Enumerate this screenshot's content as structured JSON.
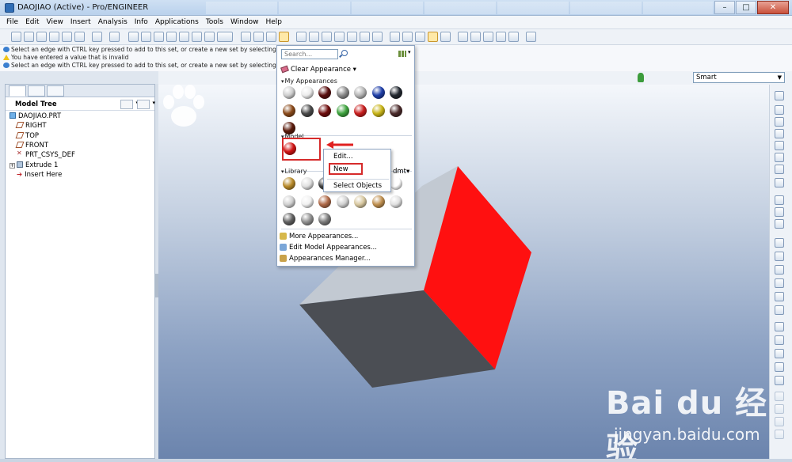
{
  "window": {
    "title": "DAOJIAO (Active) - Pro/ENGINEER",
    "controls": [
      "–",
      "□",
      "✕"
    ]
  },
  "menubar": [
    "File",
    "Edit",
    "View",
    "Insert",
    "Analysis",
    "Info",
    "Applications",
    "Tools",
    "Window",
    "Help"
  ],
  "messages": [
    {
      "text": "Select an edge with CTRL key pressed to add to this set, or create a new set by selecting an edge or a",
      "type": "info"
    },
    {
      "text": "You have entered a value that is invalid",
      "type": "warning"
    },
    {
      "text": "Select an edge with CTRL key pressed to add to this set, or create a new set by selecting an edge or a",
      "type": "info"
    }
  ],
  "filter": {
    "value": "Smart"
  },
  "model_tree": {
    "title": "Model Tree",
    "items": [
      {
        "label": "DAOJIAO.PRT",
        "icon": "part-icon"
      },
      {
        "label": "RIGHT",
        "icon": "datum-plane-icon"
      },
      {
        "label": "TOP",
        "icon": "datum-plane-icon"
      },
      {
        "label": "FRONT",
        "icon": "datum-plane-icon"
      },
      {
        "label": "PRT_CSYS_DEF",
        "icon": "csys-icon"
      },
      {
        "label": "Extrude 1",
        "icon": "extrude-icon"
      },
      {
        "label": "Insert Here",
        "icon": "insert-here-icon"
      }
    ]
  },
  "appearance_menu": {
    "search_placeholder": "Search...",
    "clear_label": "Clear Appearance",
    "my_label": "My Appearances",
    "model_label": "Model",
    "library_label": "Library",
    "library_value": "dmt",
    "more_label": "More Appearances...",
    "edit_model_label": "Edit Model Appearances...",
    "manager_label": "Appearances Manager...",
    "my_colors": [
      "#cfcfcf",
      "#ececec",
      "#5a0e0e",
      "#8a8a8a",
      "#b5b5b5",
      "#1f3fa8",
      "#222830",
      "#8a4a1a",
      "#4a4a4a",
      "#6e0c0c",
      "#3ea33e",
      "#c81e1e",
      "#c8b418",
      "#4a2a2a",
      "#5a1a0a"
    ],
    "model_colors": [
      "#d01414"
    ],
    "library_colors": [
      "#b88a2a",
      "#e0e0e0",
      "#404040",
      "#d8d8d8",
      "#c0c0c0",
      "#f0f0f0",
      "#ffffff",
      "#d0d0d0",
      "#f0f0f0",
      "#b06a48",
      "#d0d0d0",
      "#d8c8a0",
      "#c09050",
      "#e0e0e0",
      "#606060",
      "#909090",
      "#7a7a7a"
    ]
  },
  "context_menu": {
    "items": [
      "Edit...",
      "New",
      "Select Objects"
    ]
  },
  "watermark": {
    "logo": "Bai  du 经验",
    "url": "jingyan.baidu.com"
  }
}
